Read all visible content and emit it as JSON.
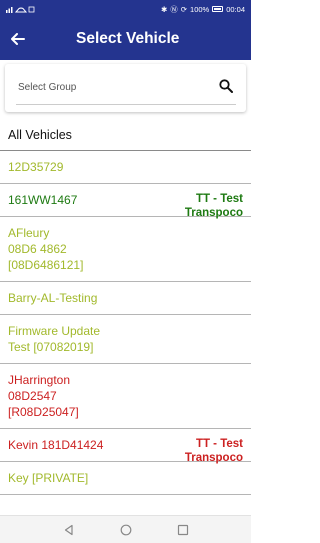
{
  "status_bar": {
    "left_icons": "   ",
    "battery_percent": "100%",
    "time": "00:04"
  },
  "app_bar": {
    "title": "Select Vehicle"
  },
  "search": {
    "placeholder": "Select Group"
  },
  "list": {
    "all_label": "All Vehicles",
    "items": [
      {
        "name": "12D35729",
        "group": "",
        "color": "#a2b92c"
      },
      {
        "name": "161WW1467",
        "group": "TT - Test\nTranspoco",
        "color": "#1e7a12"
      },
      {
        "name": "AFleury\n08D6 4862\n[08D6486121]",
        "group": "",
        "color": "#a2b92c"
      },
      {
        "name": "Barry-AL-Testing",
        "group": "",
        "color": "#a2b92c"
      },
      {
        "name": "Firmware Update\nTest [07082019]",
        "group": "",
        "color": "#a2b92c"
      },
      {
        "name": "JHarrington\n08D2547\n[R08D25047]",
        "group": "",
        "color": "#cc2121"
      },
      {
        "name": "Kevin 181D41424",
        "group": "TT - Test\nTranspoco",
        "color": "#cc2121"
      },
      {
        "name": "Key [PRIVATE]",
        "group": "",
        "color": "#a2b92c"
      }
    ]
  },
  "nav_bar": {
    "icons": [
      "back-triangle-icon",
      "home-circle-icon",
      "recents-square-icon"
    ]
  }
}
